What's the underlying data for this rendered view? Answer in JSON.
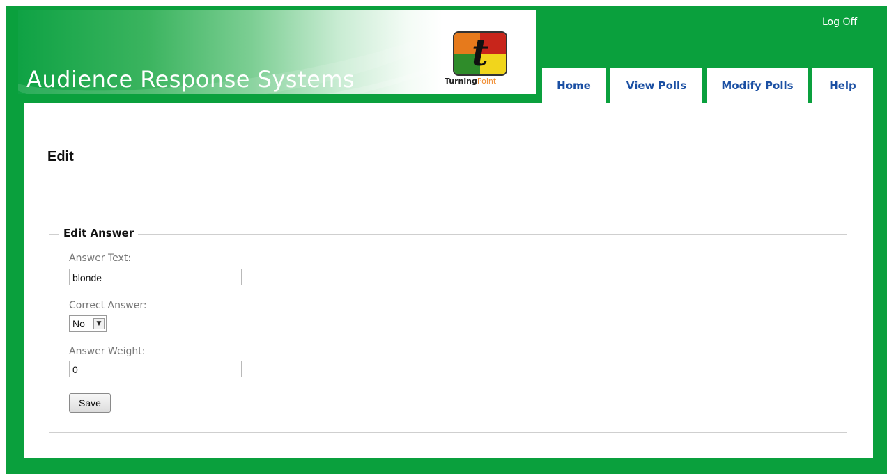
{
  "header": {
    "site_title": "Audience Response Systems",
    "logo_letter": "t",
    "logo_caption_main": "Turning",
    "logo_caption_accent": "Point",
    "logoff_label": "Log Off",
    "nav": {
      "home": "Home",
      "view_polls": "View Polls",
      "modify_polls": "Modify Polls",
      "help": "Help"
    }
  },
  "main": {
    "page_title": "Edit",
    "form": {
      "legend": "Edit Answer",
      "answer_text_label": "Answer Text:",
      "answer_text_value": "blonde",
      "correct_answer_label": "Correct Answer:",
      "correct_answer_value": "No",
      "answer_weight_label": "Answer Weight:",
      "answer_weight_value": "0",
      "save_label": "Save"
    }
  },
  "colors": {
    "brand_green": "#0aa03d",
    "nav_text": "#1a4fa3"
  }
}
